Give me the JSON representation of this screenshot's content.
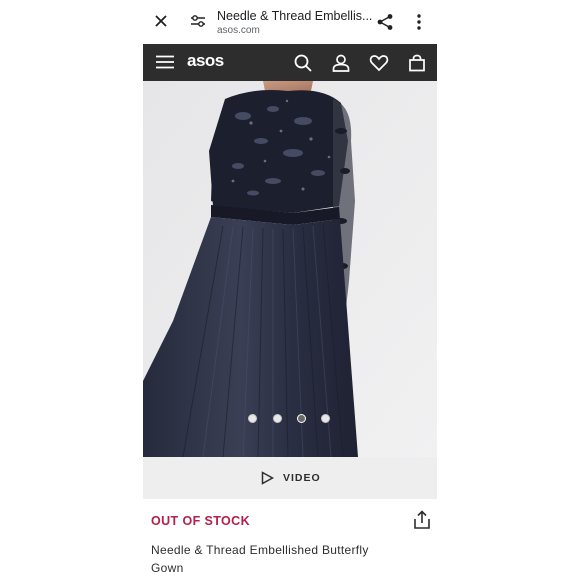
{
  "browser": {
    "title": "Needle & Thread Embellis...",
    "url": "asos.com"
  },
  "nav": {
    "logo": "asos"
  },
  "gallery": {
    "dot_count": 4,
    "active_index": 2
  },
  "video": {
    "label": "VIDEO"
  },
  "product": {
    "stock_status": "OUT OF STOCK",
    "name": "Needle & Thread Embellished Butterfly Gown"
  },
  "colors": {
    "nav_bg": "#2d2d2d",
    "stock_red": "#b3204a",
    "dress_navy": "#1e2233"
  },
  "icons": [
    "close-icon",
    "page-settings-icon",
    "share-icon",
    "more-vert-icon",
    "menu-icon",
    "search-icon",
    "account-icon",
    "heart-icon",
    "bag-icon",
    "play-icon",
    "share-upload-icon"
  ]
}
